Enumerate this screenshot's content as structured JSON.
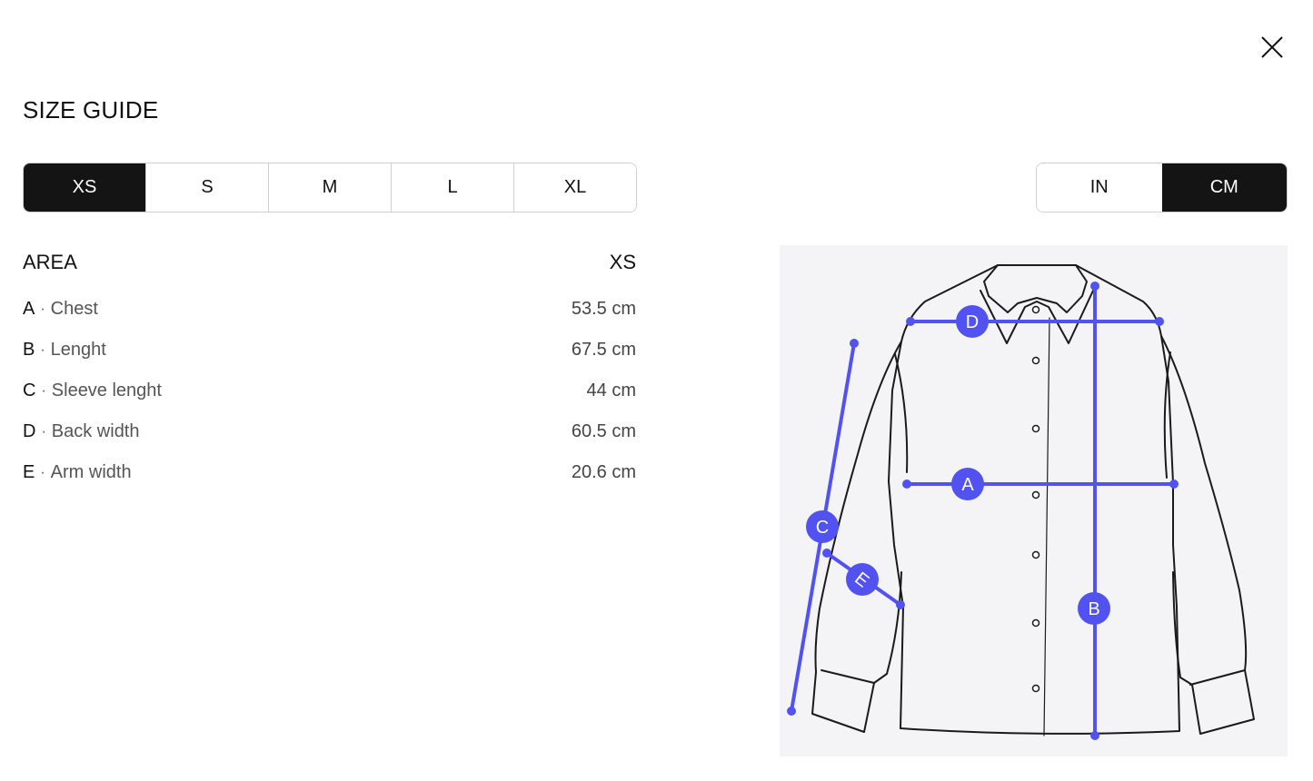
{
  "title": "SIZE GUIDE",
  "sizes": [
    "XS",
    "S",
    "M",
    "L",
    "XL"
  ],
  "selected_size": "XS",
  "units": [
    "IN",
    "CM"
  ],
  "selected_unit": "CM",
  "table": {
    "area_header": "AREA",
    "size_header": "XS",
    "rows": [
      {
        "key": "A",
        "label": "Chest",
        "value": "53.5 cm"
      },
      {
        "key": "B",
        "label": "Lenght",
        "value": "67.5 cm"
      },
      {
        "key": "C",
        "label": "Sleeve lenght",
        "value": "44 cm"
      },
      {
        "key": "D",
        "label": "Back width",
        "value": "60.5 cm"
      },
      {
        "key": "E",
        "label": "Arm width",
        "value": "20.6 cm"
      }
    ]
  },
  "diagram": {
    "markers": [
      "A",
      "B",
      "C",
      "D",
      "E"
    ],
    "accent_color": "#5252f0"
  }
}
